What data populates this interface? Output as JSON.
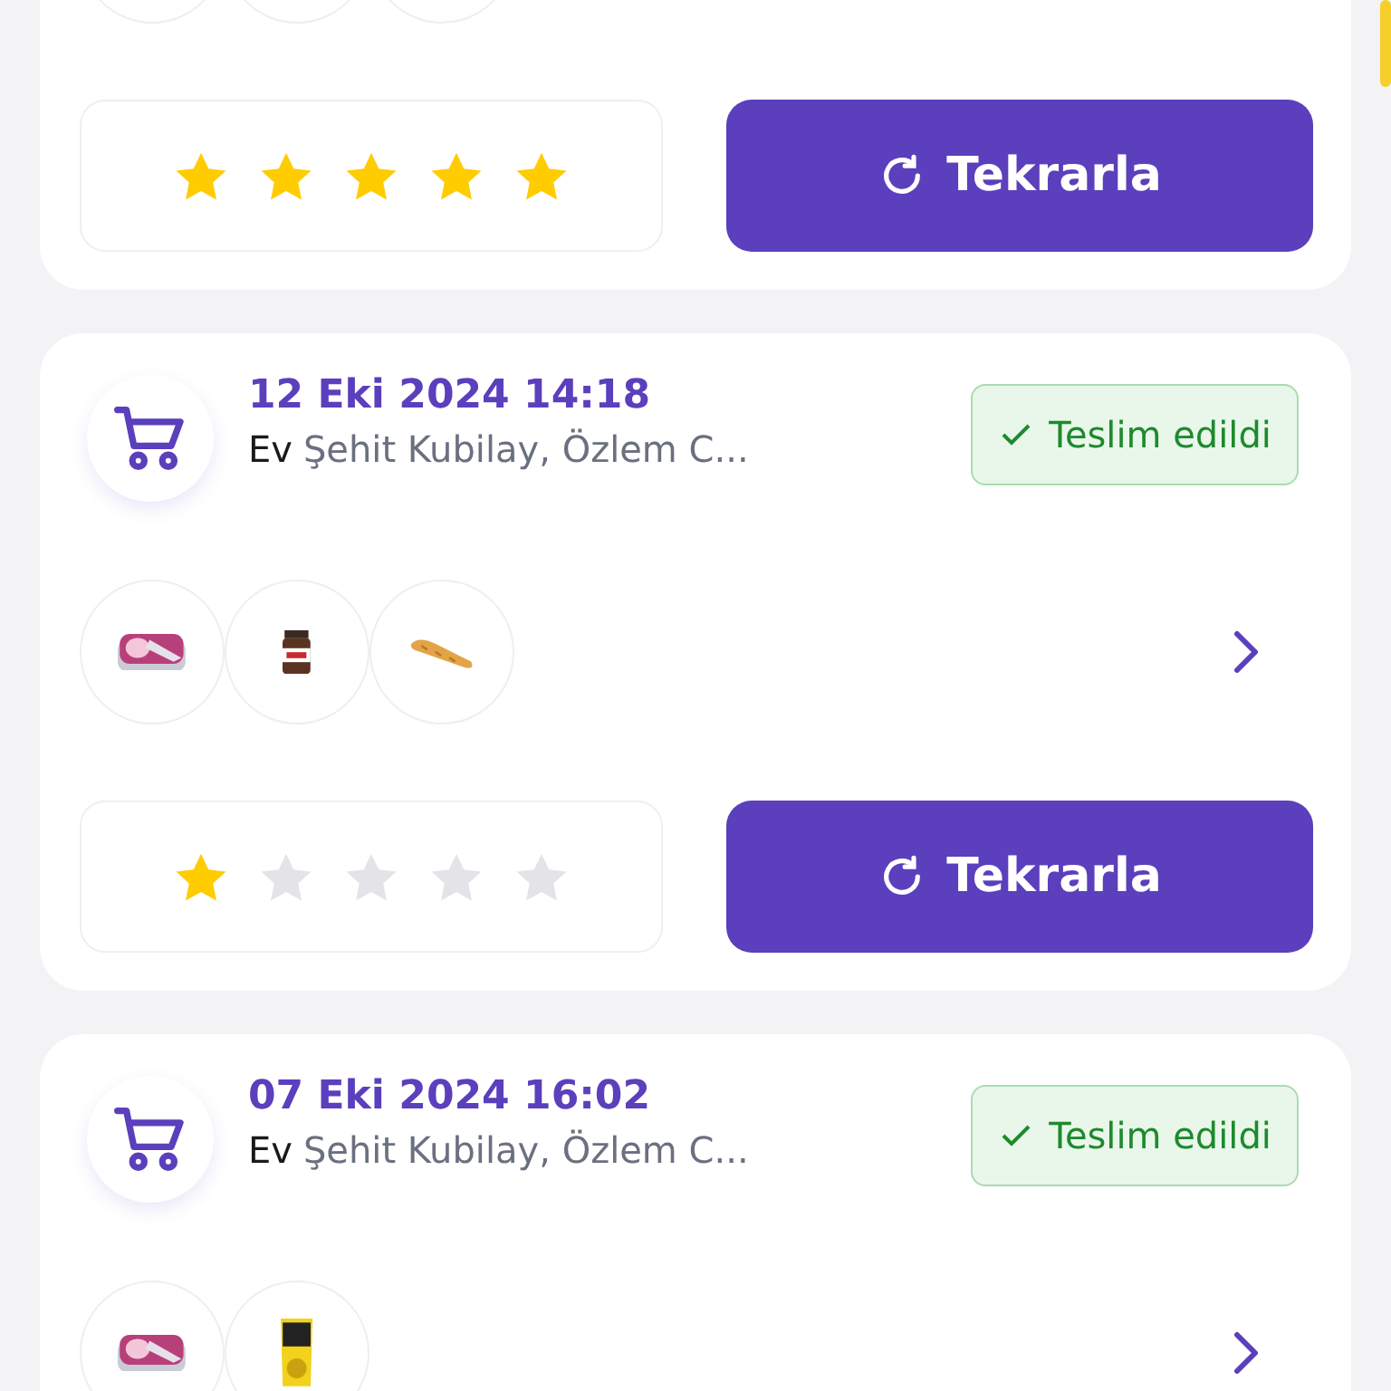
{
  "orders": [
    {
      "products": [
        {
          "kind": "cropped"
        },
        {
          "kind": "cropped"
        },
        {
          "kind": "cropped"
        }
      ],
      "stars": 5,
      "repeat_button": "Tekrarla"
    },
    {
      "date": "12 Eki 2024 14:18",
      "place": "Ev",
      "address": "Şehit Kubilay, Özlem C...",
      "status": {
        "kind": "delivered",
        "label": "Teslim edildi"
      },
      "products": [
        {
          "kind": "picture"
        },
        {
          "kind": "picture"
        },
        {
          "kind": "picture"
        }
      ],
      "stars": 1,
      "repeat_button": "Tekrarla"
    },
    {
      "date": "07 Eki 2024 16:02",
      "place": "Ev",
      "address": "Şehit Kubilay, Özlem C...",
      "status": {
        "kind": "delivered",
        "label": "Teslim edildi"
      },
      "products": [
        {
          "kind": "picture"
        },
        {
          "kind": "picture"
        }
      ]
    }
  ]
}
